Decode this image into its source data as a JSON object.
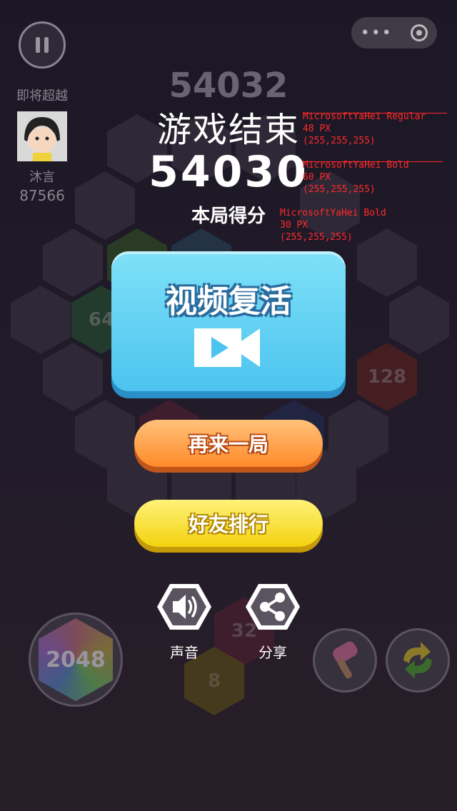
{
  "header": {
    "pause_icon": "pause-icon",
    "more_icon": "more-dots-icon",
    "close_icon": "target-icon",
    "background_score": "54032"
  },
  "rival": {
    "label": "即将超越",
    "name": "沐言",
    "score": "87566"
  },
  "game_over": {
    "title": "游戏结束",
    "score": "54030",
    "score_label": "本局得分"
  },
  "annotations": [
    {
      "font": "MicrosoftYaHei Regular",
      "size": "48 PX",
      "color": "(255,255,255)"
    },
    {
      "font": "MicrosoftYaHei Bold",
      "size": "60 PX",
      "color": "(255,255,255)"
    },
    {
      "font": "MicrosoftYaHei Bold",
      "size": "30 PX",
      "color": "(255,255,255)"
    }
  ],
  "buttons": {
    "revive_label": "视频复活",
    "revive_icon": "video-camera-icon",
    "again_label": "再来一局",
    "rank_label": "好友排行",
    "sound_label": "声音",
    "share_label": "分享"
  },
  "board_tiles": [
    "64",
    "128",
    "32",
    "8"
  ],
  "bottom": {
    "tile_2048": "2048",
    "hammer_icon": "hammer-icon",
    "swap_icon": "swap-icon"
  },
  "colors": {
    "revive_bg": "#5ccdf3",
    "again_bg": "#ff9a3c",
    "rank_bg": "#f6dc24",
    "annotation": "#ff2a2a"
  }
}
